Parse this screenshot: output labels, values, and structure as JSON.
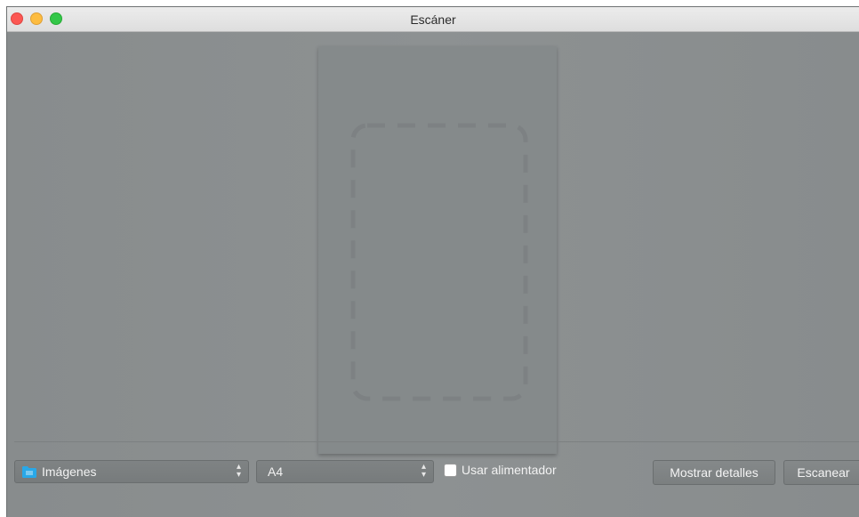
{
  "window": {
    "title": "Escáner"
  },
  "toolbar": {
    "destination": {
      "label": "Imágenes",
      "icon": "folder-icon"
    },
    "size": {
      "label": "A4"
    },
    "feeder": {
      "label": "Usar alimentador",
      "checked": false
    },
    "details_button": "Mostrar detalles",
    "scan_button": "Escanear"
  },
  "colors": {
    "close": "#fc5753",
    "minimize": "#fdbc40",
    "maximize": "#33c748",
    "folder": "#29a8e8"
  }
}
